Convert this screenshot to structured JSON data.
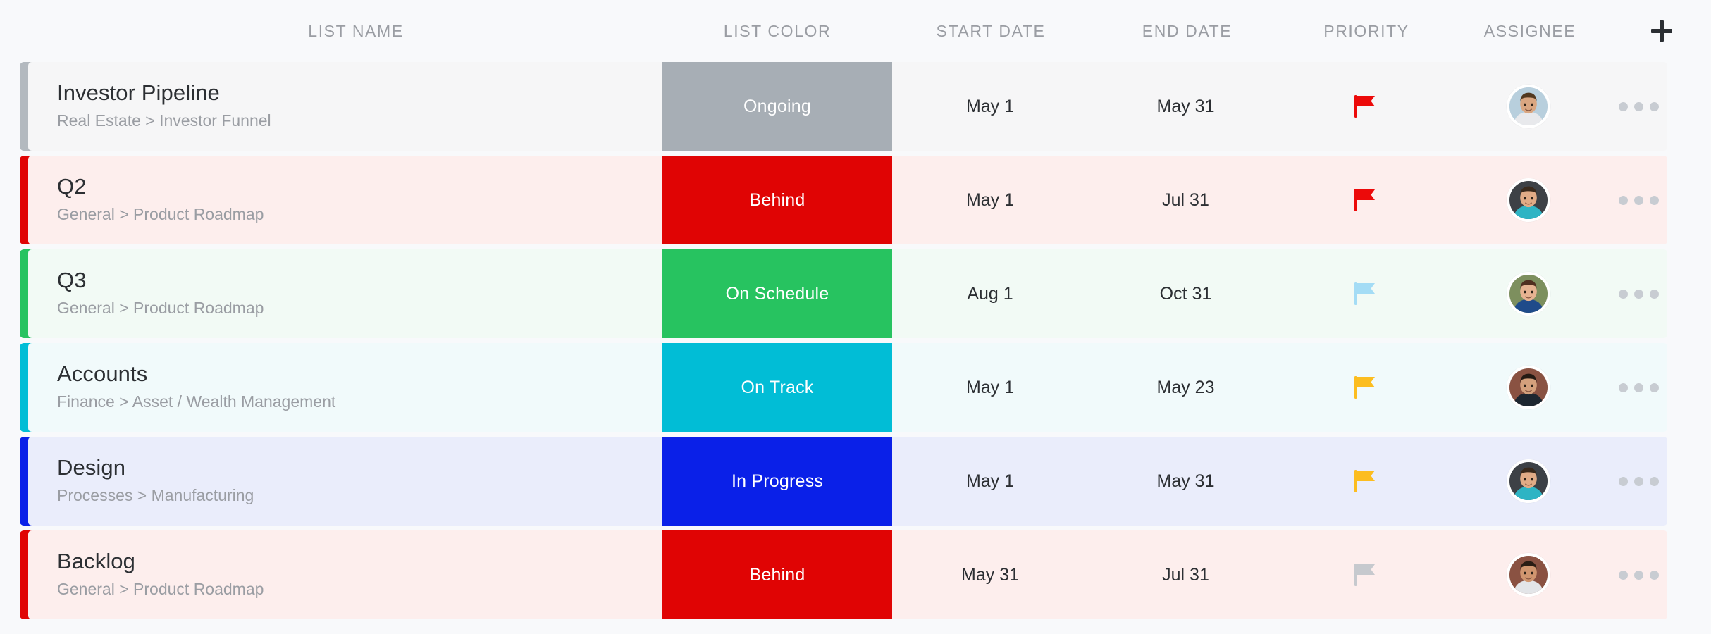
{
  "header": {
    "columns": [
      {
        "key": "list_name",
        "label": "LIST NAME"
      },
      {
        "key": "list_color",
        "label": "LIST COLOR"
      },
      {
        "key": "start_date",
        "label": "START DATE"
      },
      {
        "key": "end_date",
        "label": "END DATE"
      },
      {
        "key": "priority",
        "label": "PRIORITY"
      },
      {
        "key": "assignee",
        "label": "ASSIGNEE"
      }
    ],
    "add_column_icon": "plus-icon"
  },
  "rows": [
    {
      "name": "Investor Pipeline",
      "path": "Real Estate > Investor Funnel",
      "status_label": "Ongoing",
      "status_color": "#a7aeb5",
      "row_bg": "#f6f6f7",
      "accent_color": "#b3b9bf",
      "start_date": "May 1",
      "end_date": "May 31",
      "priority_flag_color": "#ec0a0a",
      "priority_level": "urgent",
      "assignee_name": "assignee-avatar"
    },
    {
      "name": "Q2",
      "path": "General > Product Roadmap",
      "status_label": "Behind",
      "status_color": "#e00404",
      "row_bg": "#fdeeed",
      "accent_color": "#e00404",
      "start_date": "May 1",
      "end_date": "Jul 31",
      "priority_flag_color": "#ec0a0a",
      "priority_level": "urgent",
      "assignee_name": "assignee-avatar"
    },
    {
      "name": "Q3",
      "path": "General > Product Roadmap",
      "status_label": "On Schedule",
      "status_color": "#27c360",
      "row_bg": "#f2faf5",
      "accent_color": "#27c360",
      "start_date": "Aug 1",
      "end_date": "Oct 31",
      "priority_flag_color": "#a4dcf5",
      "priority_level": "low",
      "assignee_name": "assignee-avatar"
    },
    {
      "name": "Accounts",
      "path": "Finance > Asset / Wealth Management",
      "status_label": "On Track",
      "status_color": "#01bdd6",
      "row_bg": "#f1fafb",
      "accent_color": "#01bdd6",
      "start_date": "May 1",
      "end_date": "May 23",
      "priority_flag_color": "#fcbd20",
      "priority_level": "high",
      "assignee_name": "assignee-avatar"
    },
    {
      "name": "Design",
      "path": "Processes > Manufacturing",
      "status_label": "In Progress",
      "status_color": "#0a20e8",
      "row_bg": "#eaedfb",
      "accent_color": "#0a20e8",
      "start_date": "May 1",
      "end_date": "May 31",
      "priority_flag_color": "#fcbd20",
      "priority_level": "high",
      "assignee_name": "assignee-avatar"
    },
    {
      "name": "Backlog",
      "path": "General > Product Roadmap",
      "status_label": "Behind",
      "status_color": "#e00404",
      "row_bg": "#fdeeed",
      "accent_color": "#e00404",
      "start_date": "May 31",
      "end_date": "Jul 31",
      "priority_flag_color": "#c6c9ce",
      "priority_level": "none",
      "assignee_name": "assignee-avatar"
    }
  ],
  "row_actions": {
    "more_icon": "ellipsis-icon"
  },
  "palette": {
    "page_bg": "#f8f9fb",
    "header_text": "#9a9da3",
    "body_text": "#2c2f33",
    "muted_text": "#9a9da3"
  }
}
